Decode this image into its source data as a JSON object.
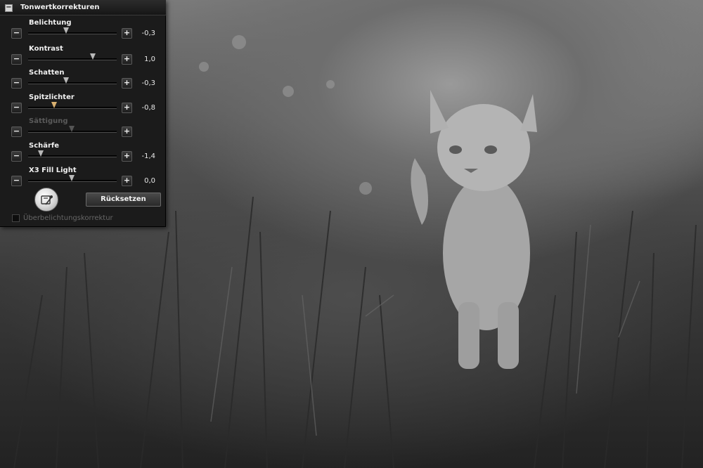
{
  "panel": {
    "title": "Tonwertkorrekturen",
    "reset_label": "Rücksetzen",
    "overexposure_label": "Überbelichtungskorrektur",
    "overexposure_checked": false,
    "controls": [
      {
        "label": "Belichtung",
        "value": "-0,3",
        "position": 0.43,
        "enabled": true,
        "accent": false
      },
      {
        "label": "Kontrast",
        "value": "1,0",
        "position": 0.73,
        "enabled": true,
        "accent": false
      },
      {
        "label": "Schatten",
        "value": "-0,3",
        "position": 0.43,
        "enabled": true,
        "accent": false
      },
      {
        "label": "Spitzlichter",
        "value": "-0,8",
        "position": 0.29,
        "enabled": true,
        "accent": true
      },
      {
        "label": "Sättigung",
        "value": "",
        "position": 0.49,
        "enabled": false,
        "accent": false
      },
      {
        "label": "Schärfe",
        "value": "-1,4",
        "position": 0.14,
        "enabled": true,
        "accent": false
      },
      {
        "label": "X3 Fill Light",
        "value": "0,0",
        "position": 0.49,
        "enabled": true,
        "accent": false
      }
    ],
    "minus_glyph": "−",
    "plus_glyph": "+",
    "collapse_glyph": "−"
  },
  "icons": {
    "collapse": "collapse-icon",
    "fill_light": "fill-light-icon"
  },
  "colors": {
    "panel_bg": "#1b1b1b",
    "accent_thumb": "#d9b070",
    "thumb": "#b9b9b9"
  }
}
